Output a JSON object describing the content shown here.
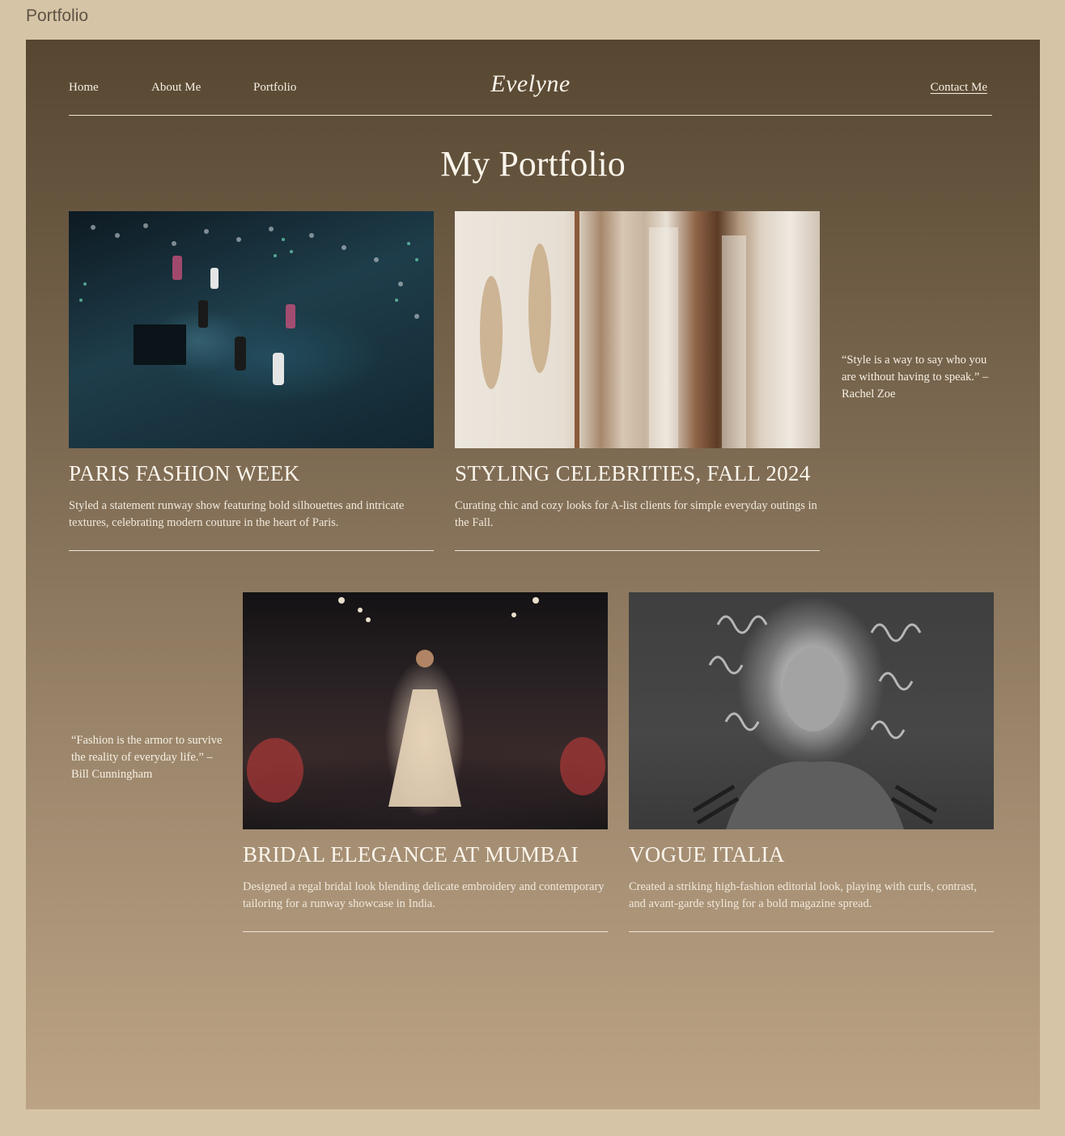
{
  "frame_label": "Portfolio",
  "nav": {
    "links": [
      "Home",
      "About Me",
      "Portfolio"
    ],
    "brand": "Evelyne",
    "contact": "Contact Me"
  },
  "page_title": "My Portfolio",
  "projects": [
    {
      "title": "PARIS FASHION WEEK",
      "description": "Styled a statement runway show featuring bold silhouettes and intricate textures, celebrating modern couture in the heart of Paris."
    },
    {
      "title": "STYLING CELEBRITIES, FALL 2024",
      "description": "Curating chic and cozy looks for A-list clients for simple everyday outings in the Fall."
    },
    {
      "title": "BRIDAL ELEGANCE AT MUMBAI",
      "description": "Designed a regal bridal look blending delicate embroidery and contemporary tailoring for a runway showcase in India."
    },
    {
      "title": "VOGUE ITALIA",
      "description": "Created a striking high-fashion editorial look, playing with curls, contrast, and avant-garde styling for a bold magazine spread."
    }
  ],
  "quotes": [
    "“Style is a way to say who you are without having to speak.” – Rachel Zoe",
    "“Fashion is the armor to survive the reality of everyday life.” – Bill Cunningham"
  ],
  "colors": {
    "page_background": "#d6c4a6",
    "gradient_top": "#574731",
    "gradient_bottom": "#bca385",
    "text_light": "#fbf5ec"
  }
}
